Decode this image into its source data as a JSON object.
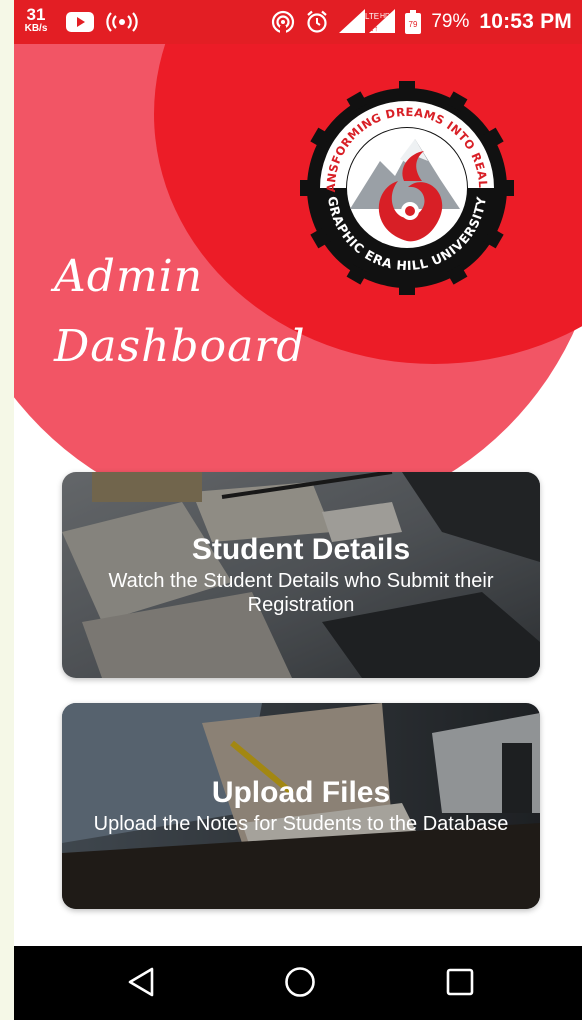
{
  "status_bar": {
    "net_speed_value": "31",
    "net_speed_unit": "KB/s",
    "battery_percent": "79%",
    "battery_level": "79",
    "time": "10:53 PM",
    "icons": [
      "youtube-icon",
      "radio-icon",
      "hotspot-icon",
      "alarm-icon",
      "signal-icon",
      "lte-hd-icon",
      "battery-icon"
    ]
  },
  "header": {
    "title": "Admin\nDashboard",
    "logo": {
      "top_text": "TRANSFORMING DREAMS INTO REALITY",
      "bottom_text": "GRAPHIC ERA HILL UNIVERSITY"
    }
  },
  "cards": [
    {
      "title": "Student Details",
      "subtitle": "Watch the Student Details who Submit their Registration"
    },
    {
      "title": "Upload Files",
      "subtitle": "Upload the Notes for Students to the Database"
    }
  ],
  "nav_bar": {
    "icons": [
      "back-icon",
      "home-icon",
      "recents-icon"
    ]
  },
  "colors": {
    "status_bar": "#e31e24",
    "outer_circle": "#f25565",
    "inner_circle": "#ec1c27",
    "nav_bar": "#000000"
  }
}
